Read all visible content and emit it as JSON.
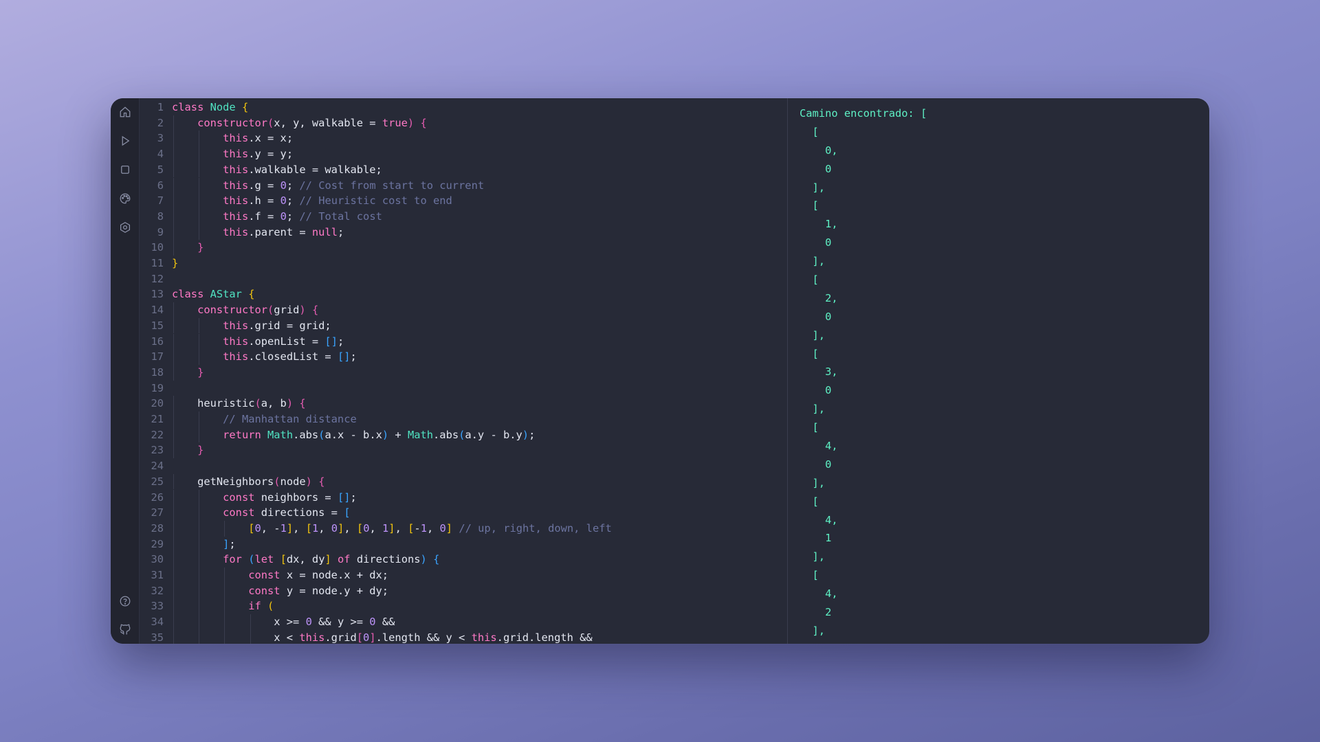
{
  "sidebar": {
    "top_icons": [
      "home-icon",
      "play-icon",
      "stop-icon",
      "palette-icon",
      "settings-icon"
    ],
    "bottom_icons": [
      "help-icon",
      "github-icon"
    ]
  },
  "editor": {
    "language": "javascript",
    "lines": [
      [
        [
          "kw",
          "class "
        ],
        [
          "cls",
          "Node "
        ],
        [
          "b1",
          "{"
        ]
      ],
      [
        [
          "t",
          "    "
        ],
        [
          "kw",
          "constructor"
        ],
        [
          "b2",
          "("
        ],
        [
          "t",
          "x, y, walkable = "
        ],
        [
          "lit",
          "true"
        ],
        [
          "b2",
          ")"
        ],
        [
          "t",
          " "
        ],
        [
          "b2",
          "{"
        ]
      ],
      [
        [
          "t",
          "        "
        ],
        [
          "th",
          "this"
        ],
        [
          "t",
          ".x = x;"
        ]
      ],
      [
        [
          "t",
          "        "
        ],
        [
          "th",
          "this"
        ],
        [
          "t",
          ".y = y;"
        ]
      ],
      [
        [
          "t",
          "        "
        ],
        [
          "th",
          "this"
        ],
        [
          "t",
          ".walkable = walkable;"
        ]
      ],
      [
        [
          "t",
          "        "
        ],
        [
          "th",
          "this"
        ],
        [
          "t",
          ".g = "
        ],
        [
          "num",
          "0"
        ],
        [
          "t",
          "; "
        ],
        [
          "com",
          "// Cost from start to current"
        ]
      ],
      [
        [
          "t",
          "        "
        ],
        [
          "th",
          "this"
        ],
        [
          "t",
          ".h = "
        ],
        [
          "num",
          "0"
        ],
        [
          "t",
          "; "
        ],
        [
          "com",
          "// Heuristic cost to end"
        ]
      ],
      [
        [
          "t",
          "        "
        ],
        [
          "th",
          "this"
        ],
        [
          "t",
          ".f = "
        ],
        [
          "num",
          "0"
        ],
        [
          "t",
          "; "
        ],
        [
          "com",
          "// Total cost"
        ]
      ],
      [
        [
          "t",
          "        "
        ],
        [
          "th",
          "this"
        ],
        [
          "t",
          ".parent = "
        ],
        [
          "lit",
          "null"
        ],
        [
          "t",
          ";"
        ]
      ],
      [
        [
          "t",
          "    "
        ],
        [
          "b2",
          "}"
        ]
      ],
      [
        [
          "b1",
          "}"
        ]
      ],
      [
        [
          "t",
          ""
        ]
      ],
      [
        [
          "kw",
          "class "
        ],
        [
          "cls",
          "AStar "
        ],
        [
          "b1",
          "{"
        ]
      ],
      [
        [
          "t",
          "    "
        ],
        [
          "kw",
          "constructor"
        ],
        [
          "b2",
          "("
        ],
        [
          "t",
          "grid"
        ],
        [
          "b2",
          ")"
        ],
        [
          "t",
          " "
        ],
        [
          "b2",
          "{"
        ]
      ],
      [
        [
          "t",
          "        "
        ],
        [
          "th",
          "this"
        ],
        [
          "t",
          ".grid = grid;"
        ]
      ],
      [
        [
          "t",
          "        "
        ],
        [
          "th",
          "this"
        ],
        [
          "t",
          ".openList = "
        ],
        [
          "b3",
          "[]"
        ],
        [
          "t",
          ";"
        ]
      ],
      [
        [
          "t",
          "        "
        ],
        [
          "th",
          "this"
        ],
        [
          "t",
          ".closedList = "
        ],
        [
          "b3",
          "[]"
        ],
        [
          "t",
          ";"
        ]
      ],
      [
        [
          "t",
          "    "
        ],
        [
          "b2",
          "}"
        ]
      ],
      [
        [
          "t",
          ""
        ]
      ],
      [
        [
          "t",
          "    heuristic"
        ],
        [
          "b2",
          "("
        ],
        [
          "t",
          "a, b"
        ],
        [
          "b2",
          ")"
        ],
        [
          "t",
          " "
        ],
        [
          "b2",
          "{"
        ]
      ],
      [
        [
          "t",
          "        "
        ],
        [
          "com",
          "// Manhattan distance"
        ]
      ],
      [
        [
          "t",
          "        "
        ],
        [
          "kw",
          "return "
        ],
        [
          "bi",
          "Math"
        ],
        [
          "t",
          ".abs"
        ],
        [
          "b3",
          "("
        ],
        [
          "t",
          "a.x - b.x"
        ],
        [
          "b3",
          ")"
        ],
        [
          "t",
          " + "
        ],
        [
          "bi",
          "Math"
        ],
        [
          "t",
          ".abs"
        ],
        [
          "b3",
          "("
        ],
        [
          "t",
          "a.y - b.y"
        ],
        [
          "b3",
          ")"
        ],
        [
          "t",
          ";"
        ]
      ],
      [
        [
          "t",
          "    "
        ],
        [
          "b2",
          "}"
        ]
      ],
      [
        [
          "t",
          ""
        ]
      ],
      [
        [
          "t",
          "    getNeighbors"
        ],
        [
          "b2",
          "("
        ],
        [
          "t",
          "node"
        ],
        [
          "b2",
          ")"
        ],
        [
          "t",
          " "
        ],
        [
          "b2",
          "{"
        ]
      ],
      [
        [
          "t",
          "        "
        ],
        [
          "kw",
          "const "
        ],
        [
          "t",
          "neighbors = "
        ],
        [
          "b3",
          "[]"
        ],
        [
          "t",
          ";"
        ]
      ],
      [
        [
          "t",
          "        "
        ],
        [
          "kw",
          "const "
        ],
        [
          "t",
          "directions = "
        ],
        [
          "b3",
          "["
        ]
      ],
      [
        [
          "t",
          "            "
        ],
        [
          "b1",
          "["
        ],
        [
          "num",
          "0"
        ],
        [
          "t",
          ", -"
        ],
        [
          "num",
          "1"
        ],
        [
          "b1",
          "]"
        ],
        [
          "t",
          ", "
        ],
        [
          "b1",
          "["
        ],
        [
          "num",
          "1"
        ],
        [
          "t",
          ", "
        ],
        [
          "num",
          "0"
        ],
        [
          "b1",
          "]"
        ],
        [
          "t",
          ", "
        ],
        [
          "b1",
          "["
        ],
        [
          "num",
          "0"
        ],
        [
          "t",
          ", "
        ],
        [
          "num",
          "1"
        ],
        [
          "b1",
          "]"
        ],
        [
          "t",
          ", "
        ],
        [
          "b1",
          "["
        ],
        [
          "t",
          "-"
        ],
        [
          "num",
          "1"
        ],
        [
          "t",
          ", "
        ],
        [
          "num",
          "0"
        ],
        [
          "b1",
          "]"
        ],
        [
          "t",
          " "
        ],
        [
          "com",
          "// up, right, down, left"
        ]
      ],
      [
        [
          "t",
          "        "
        ],
        [
          "b3",
          "]"
        ],
        [
          "t",
          ";"
        ]
      ],
      [
        [
          "t",
          "        "
        ],
        [
          "kw",
          "for "
        ],
        [
          "b3",
          "("
        ],
        [
          "kw",
          "let "
        ],
        [
          "b1",
          "["
        ],
        [
          "t",
          "dx, dy"
        ],
        [
          "b1",
          "]"
        ],
        [
          "t",
          " "
        ],
        [
          "kw",
          "of "
        ],
        [
          "t",
          "directions"
        ],
        [
          "b3",
          ")"
        ],
        [
          "t",
          " "
        ],
        [
          "b3",
          "{"
        ]
      ],
      [
        [
          "t",
          "            "
        ],
        [
          "kw",
          "const "
        ],
        [
          "t",
          "x = node.x + dx;"
        ]
      ],
      [
        [
          "t",
          "            "
        ],
        [
          "kw",
          "const "
        ],
        [
          "t",
          "y = node.y + dy;"
        ]
      ],
      [
        [
          "t",
          "            "
        ],
        [
          "kw",
          "if "
        ],
        [
          "b1",
          "("
        ]
      ],
      [
        [
          "t",
          "                x >= "
        ],
        [
          "num",
          "0"
        ],
        [
          "t",
          " && y >= "
        ],
        [
          "num",
          "0"
        ],
        [
          "t",
          " &&"
        ]
      ],
      [
        [
          "t",
          "                x < "
        ],
        [
          "th",
          "this"
        ],
        [
          "t",
          ".grid"
        ],
        [
          "b2",
          "["
        ],
        [
          "num",
          "0"
        ],
        [
          "b2",
          "]"
        ],
        [
          "t",
          ".length && y < "
        ],
        [
          "th",
          "this"
        ],
        [
          "t",
          ".grid.length &&"
        ]
      ]
    ]
  },
  "output": {
    "lines": [
      "Camino encontrado: [",
      "  [",
      "    0,",
      "    0",
      "  ],",
      "  [",
      "    1,",
      "    0",
      "  ],",
      "  [",
      "    2,",
      "    0",
      "  ],",
      "  [",
      "    3,",
      "    0",
      "  ],",
      "  [",
      "    4,",
      "    0",
      "  ],",
      "  [",
      "    4,",
      "    1",
      "  ],",
      "  [",
      "    4,",
      "    2",
      "  ],",
      "  ["
    ]
  }
}
